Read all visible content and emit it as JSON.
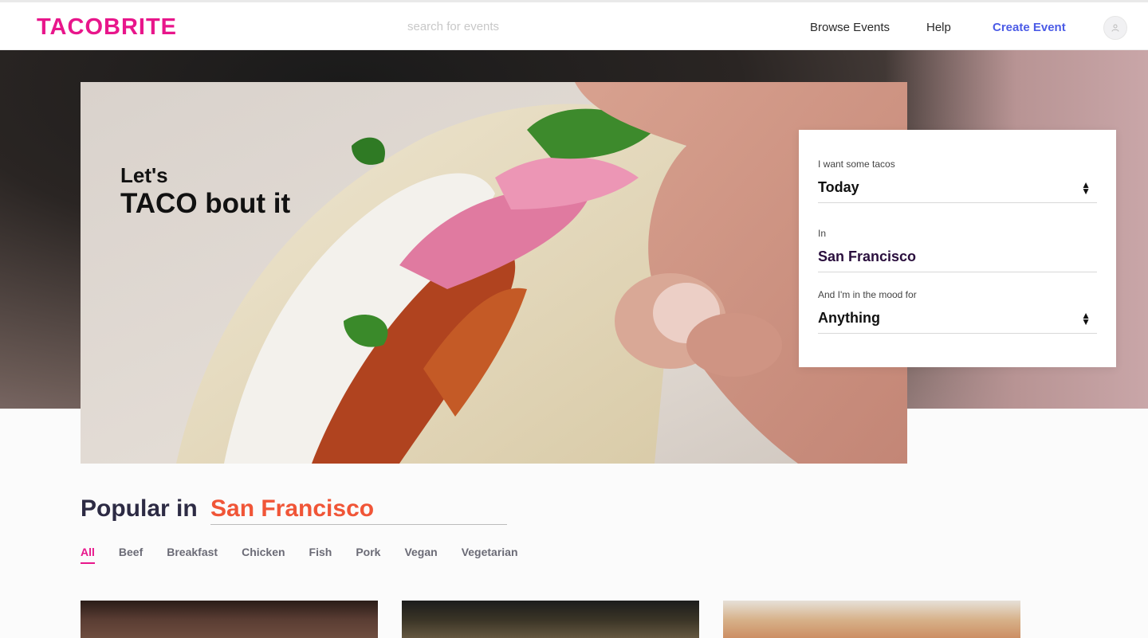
{
  "header": {
    "logo": "TACOBRITE",
    "search_placeholder": "search for events",
    "nav": {
      "browse": "Browse Events",
      "help": "Help",
      "create": "Create Event"
    }
  },
  "hero": {
    "tagline_small": "Let's",
    "tagline_big": "TACO bout it"
  },
  "filter_card": {
    "when_label": "I want some tacos",
    "when_value": "Today",
    "where_label": "In",
    "where_value": "San Francisco",
    "mood_label": "And I'm in the mood for",
    "mood_value": "Anything"
  },
  "popular": {
    "heading": "Popular in",
    "city": "San Francisco",
    "categories": [
      "All",
      "Beef",
      "Breakfast",
      "Chicken",
      "Fish",
      "Pork",
      "Vegan",
      "Vegetarian"
    ]
  },
  "colors": {
    "brand": "#e8168b",
    "accent_link": "#4b5be6",
    "city_orange": "#f05537"
  }
}
